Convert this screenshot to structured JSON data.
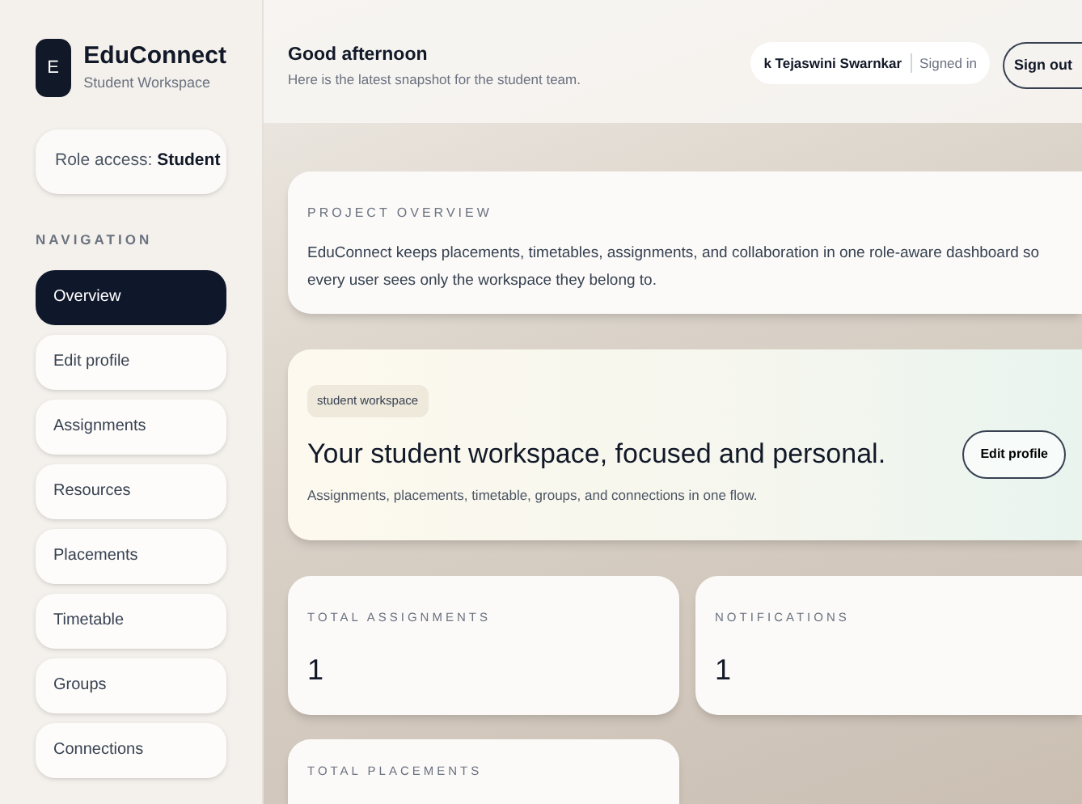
{
  "brand": {
    "logo_letter": "E",
    "name": "EduConnect",
    "subtitle": "Student Workspace"
  },
  "role": {
    "label": "Role access:",
    "value": "Student"
  },
  "navigation": {
    "heading": "NAVIGATION",
    "items": [
      {
        "label": "Overview",
        "selected": true
      },
      {
        "label": "Edit profile",
        "selected": false
      },
      {
        "label": "Assignments",
        "selected": false
      },
      {
        "label": "Resources",
        "selected": false
      },
      {
        "label": "Placements",
        "selected": false
      },
      {
        "label": "Timetable",
        "selected": false
      },
      {
        "label": "Groups",
        "selected": false
      },
      {
        "label": "Connections",
        "selected": false
      }
    ]
  },
  "header": {
    "greeting": "Good afternoon",
    "subtitle": "Here is the latest snapshot for the student team.",
    "user_name": "k Tejaswini Swarnkar",
    "user_status": "Signed in",
    "sign_out": "Sign out"
  },
  "overview": {
    "heading": "PROJECT OVERVIEW",
    "text": "EduConnect keeps placements, timetables, assignments, and collaboration in one role-aware dashboard so every user sees only the workspace they belong to."
  },
  "hero": {
    "tag": "student workspace",
    "title": "Your student workspace, focused and personal.",
    "text": "Assignments, placements, timetable, groups, and connections in one flow.",
    "button": "Edit profile"
  },
  "stats": [
    {
      "label": "TOTAL ASSIGNMENTS",
      "value": "1"
    },
    {
      "label": "NOTIFICATIONS",
      "value": "1"
    },
    {
      "label": "TOTAL PLACEMENTS"
    }
  ]
}
